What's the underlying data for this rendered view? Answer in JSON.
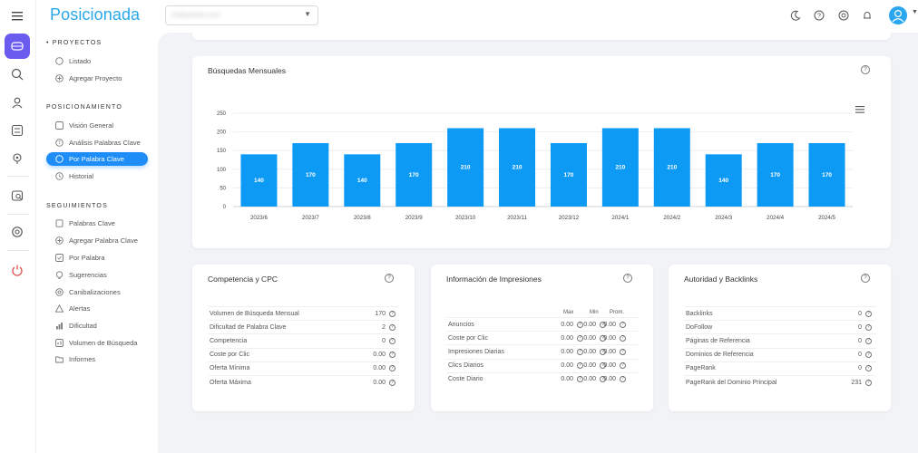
{
  "app": {
    "logo": "Posicionada"
  },
  "topbar": {
    "project_select_value": "midominio.com",
    "icons": [
      "moon-icon",
      "help-icon",
      "whatsapp-icon",
      "bell-icon",
      "user-avatar-icon"
    ]
  },
  "rail": {
    "icons": [
      "ranking-icon",
      "search-icon",
      "users-icon",
      "checklist-icon",
      "location-icon",
      "analysis-icon",
      "settings-icon",
      "power-icon"
    ]
  },
  "sidebar": {
    "sections": [
      "PROYECTOS",
      "POSICIONAMIENTO",
      "SEGUIMIENTOS"
    ],
    "proyectos": [
      {
        "label": "Listado"
      },
      {
        "label": "Agregar Proyecto"
      }
    ],
    "posicionamiento": [
      {
        "label": "Visión General"
      },
      {
        "label": "Análisis Palabras Clave"
      },
      {
        "label": "Por Palabra Clave"
      },
      {
        "label": "Historial"
      }
    ],
    "seguimientos": [
      {
        "label": "Palabras Clave"
      },
      {
        "label": "Agregar Palabra Clave"
      },
      {
        "label": "Por Palabra"
      },
      {
        "label": "Sugerencias"
      },
      {
        "label": "Canibalizaciones"
      },
      {
        "label": "Alertas"
      },
      {
        "label": "Dificultad"
      },
      {
        "label": "Volumen de Búsqueda"
      },
      {
        "label": "Informes"
      }
    ]
  },
  "monthly": {
    "title": "Búsquedas Mensuales",
    "chart_data": {
      "type": "bar",
      "categories": [
        "2023/6",
        "2023/7",
        "2023/8",
        "2023/9",
        "2023/10",
        "2023/11",
        "2023/12",
        "2024/1",
        "2024/2",
        "2024/3",
        "2024/4",
        "2024/5"
      ],
      "values": [
        140,
        170,
        140,
        170,
        210,
        210,
        170,
        210,
        210,
        140,
        170,
        170
      ],
      "ylim": [
        0,
        250
      ],
      "yticks": [
        "0",
        "50",
        "100",
        "150",
        "200",
        "250"
      ],
      "bar_color": "#0d9af5",
      "grid": true
    }
  },
  "competencia": {
    "title": "Competencia y CPC",
    "rows": [
      {
        "k": "Volumen de Búsqueda Mensual",
        "v": "170"
      },
      {
        "k": "Dificultad de Palabra Clave",
        "v": "2"
      },
      {
        "k": "Competencia",
        "v": "0"
      },
      {
        "k": "Coste por Clic",
        "v": "0.00"
      },
      {
        "k": "Oferta Mínima",
        "v": "0.00"
      },
      {
        "k": "Oferta Máxima",
        "v": "0.00"
      }
    ]
  },
  "impresiones": {
    "title": "Información de Impresiones",
    "headers": [
      "Max",
      "Min",
      "Prom."
    ],
    "rows": [
      {
        "k": "Anuncios",
        "max": "0.00",
        "min": "0.00",
        "prom": "0.00"
      },
      {
        "k": "Coste por Clic",
        "max": "0.00",
        "min": "0.00",
        "prom": "0.00"
      },
      {
        "k": "Impresiones Diarias",
        "max": "0.00",
        "min": "0.00",
        "prom": "0.00"
      },
      {
        "k": "Clics Diarios",
        "max": "0.00",
        "min": "0.00",
        "prom": "0.00"
      },
      {
        "k": "Coste Diario",
        "max": "0.00",
        "min": "0.00",
        "prom": "0.00"
      }
    ]
  },
  "autoridad": {
    "title": "Autoridad y Backlinks",
    "rows": [
      {
        "k": "Backlinks",
        "v": "0"
      },
      {
        "k": "DoFollow",
        "v": "0"
      },
      {
        "k": "Páginas de Referencia",
        "v": "0"
      },
      {
        "k": "Dominios de Referencia",
        "v": "0"
      },
      {
        "k": "PageRank",
        "v": "0"
      },
      {
        "k": "PageRank del Dominio Principal",
        "v": "231"
      }
    ]
  }
}
